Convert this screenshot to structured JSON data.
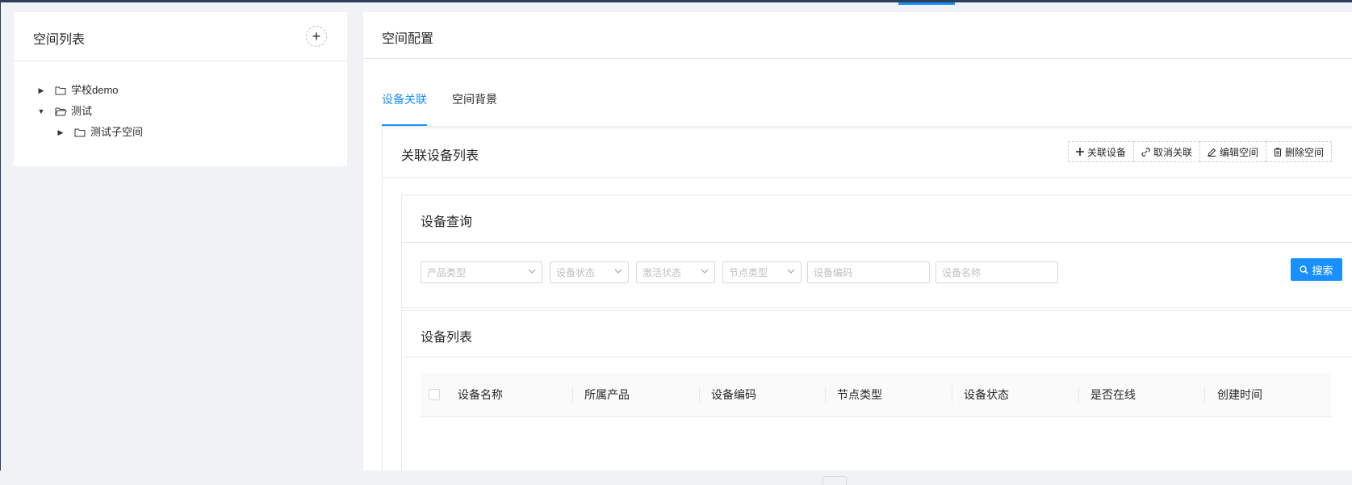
{
  "left_panel": {
    "title": "空间列表",
    "add_label": "+",
    "tree": [
      {
        "label": "学校demo"
      },
      {
        "label": "测试"
      },
      {
        "label": "测试子空间"
      }
    ]
  },
  "right_panel": {
    "title": "空间配置",
    "tabs": [
      {
        "label": "设备关联"
      },
      {
        "label": "空间背景"
      }
    ],
    "card": {
      "title": "关联设备列表",
      "actions": [
        {
          "label": "关联设备",
          "icon": "plus-icon"
        },
        {
          "label": "取消关联",
          "icon": "unlink-icon"
        },
        {
          "label": "编辑空间",
          "icon": "edit-icon"
        },
        {
          "label": "删除空间",
          "icon": "delete-icon"
        }
      ],
      "query": {
        "title": "设备查询",
        "fields": [
          {
            "placeholder": "产品类型"
          },
          {
            "placeholder": "设备状态"
          },
          {
            "placeholder": "激活状态"
          },
          {
            "placeholder": "节点类型"
          },
          {
            "placeholder": "设备编码"
          },
          {
            "placeholder": "设备名称"
          }
        ],
        "search_label": "搜索"
      },
      "list": {
        "title": "设备列表",
        "columns": [
          "设备名称",
          "所属产品",
          "设备编码",
          "节点类型",
          "设备状态",
          "是否在线",
          "创建时间"
        ]
      }
    }
  },
  "colors": {
    "accent": "#1890ff",
    "topbar": "#2b3f5c"
  }
}
